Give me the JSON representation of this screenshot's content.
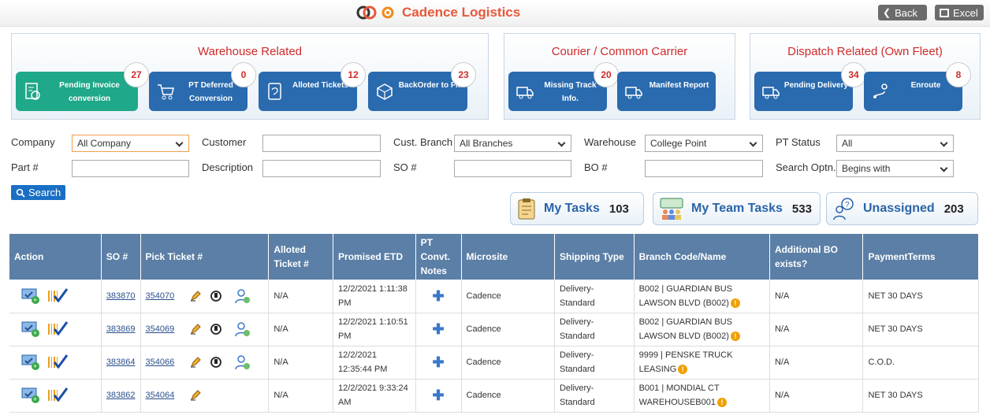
{
  "header": {
    "title": "Cadence Logistics",
    "back_label": "Back",
    "excel_label": "Excel"
  },
  "sections": [
    {
      "title": "Warehouse Related",
      "tiles": [
        {
          "label": "Pending Invoice conversion",
          "count": "27",
          "icon": "invoice-icon"
        },
        {
          "label": "PT Deferred Conversion",
          "count": "0",
          "icon": "cart-icon"
        },
        {
          "label": "Alloted Tickets",
          "count": "12",
          "icon": "ticket-icon"
        },
        {
          "label": "BackOrder to Fill",
          "count": "23",
          "icon": "box-icon"
        }
      ]
    },
    {
      "title": "Courier / Common Carrier",
      "tiles": [
        {
          "label": "Missing Track Info.",
          "count": "20",
          "icon": "truck-search-icon"
        },
        {
          "label": "Manifest Report",
          "count": "",
          "icon": "truck-icon"
        }
      ]
    },
    {
      "title": "Dispatch Related (Own Fleet)",
      "tiles": [
        {
          "label": "Pending Delivery",
          "count": "34",
          "icon": "delivery-truck-icon"
        },
        {
          "label": "Enroute",
          "count": "8",
          "icon": "route-icon"
        }
      ]
    }
  ],
  "filters": {
    "company_label": "Company",
    "company_value": "All Company",
    "customer_label": "Customer",
    "cust_branch_label": "Cust. Branch",
    "cust_branch_value": "All Branches",
    "warehouse_label": "Warehouse",
    "warehouse_value": "College Point",
    "pt_status_label": "PT Status",
    "pt_status_value": "All",
    "part_label": "Part #",
    "description_label": "Description",
    "so_label": "SO #",
    "bo_label": "BO #",
    "search_optn_label": "Search Optn.",
    "search_optn_value": "Begins with",
    "search_button": "Search"
  },
  "tasks": {
    "my_tasks_label": "My Tasks",
    "my_tasks_count": "103",
    "team_tasks_label": "My Team Tasks",
    "team_tasks_count": "533",
    "unassigned_label": "Unassigned",
    "unassigned_count": "203"
  },
  "table": {
    "headers": [
      "Action",
      "SO #",
      "Pick Ticket #",
      "Alloted Ticket #",
      "Promised ETD",
      "PT Convt. Notes",
      "Microsite",
      "Shipping Type",
      "Branch Code/Name",
      "Additional BO exists?",
      "PaymentTerms"
    ],
    "rows": [
      {
        "so": "383870",
        "pick": "354070",
        "alloted": "N/A",
        "etd": "12/2/2021 1:11:38 PM",
        "microsite": "Cadence",
        "shipping": "Delivery-Standard",
        "branch": "B002 | GUARDIAN BUS LAWSON BLVD (B002)",
        "bo": "N/A",
        "terms": "NET 30 DAYS",
        "full_icons": true
      },
      {
        "so": "383869",
        "pick": "354069",
        "alloted": "N/A",
        "etd": "12/2/2021 1:10:51 PM",
        "microsite": "Cadence",
        "shipping": "Delivery-Standard",
        "branch": "B002 | GUARDIAN BUS LAWSON BLVD (B002)",
        "bo": "N/A",
        "terms": "NET 30 DAYS",
        "full_icons": true
      },
      {
        "so": "383864",
        "pick": "354066",
        "alloted": "N/A",
        "etd": "12/2/2021 12:35:44 PM",
        "microsite": "Cadence",
        "shipping": "Delivery-Standard",
        "branch": "9999 | PENSKE TRUCK LEASING",
        "bo": "N/A",
        "terms": "C.O.D.",
        "full_icons": true
      },
      {
        "so": "383862",
        "pick": "354064",
        "alloted": "N/A",
        "etd": "12/2/2021 9:33:24 AM",
        "microsite": "Cadence",
        "shipping": "Delivery-Standard",
        "branch": "B001 | MONDIAL CT WAREHOUSEB001",
        "bo": "N/A",
        "terms": "NET 30 DAYS",
        "full_icons": false
      }
    ]
  }
}
